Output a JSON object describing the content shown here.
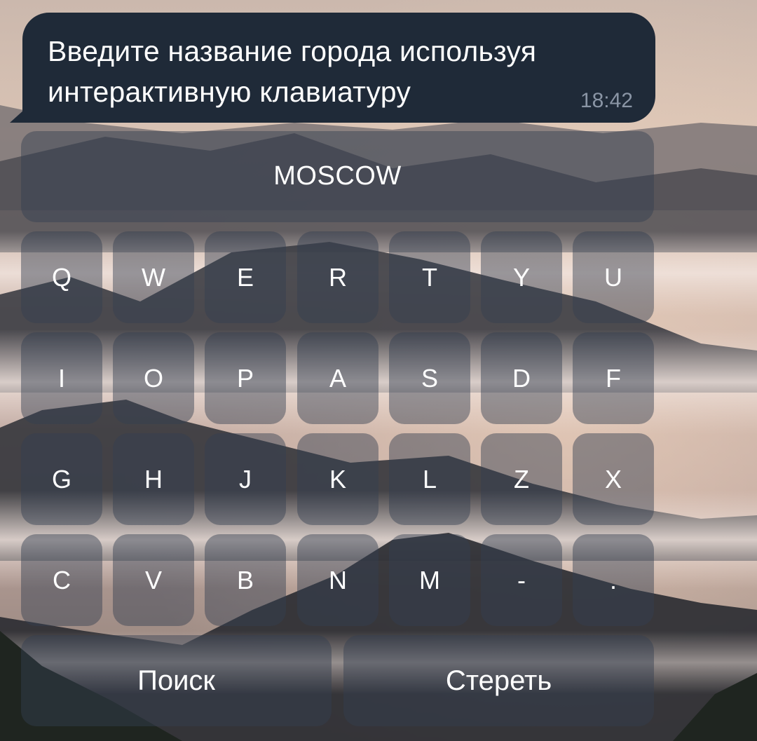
{
  "message": {
    "text": "Введите название города используя\nинтерактивную клавиатуру",
    "time": "18:42"
  },
  "keyboard": {
    "city_button_label": "MOSCOW",
    "rows": [
      [
        "Q",
        "W",
        "E",
        "R",
        "T",
        "Y",
        "U"
      ],
      [
        "I",
        "O",
        "P",
        "A",
        "S",
        "D",
        "F"
      ],
      [
        "G",
        "H",
        "J",
        "K",
        "L",
        "Z",
        "X"
      ],
      [
        "C",
        "V",
        "B",
        "N",
        "M",
        "-",
        "."
      ]
    ],
    "search_label": "Поиск",
    "erase_label": "Стереть"
  },
  "colors": {
    "bubble_background": "#1f2a38",
    "bubble_time": "#8a95a5",
    "button_text": "#ffffff"
  }
}
